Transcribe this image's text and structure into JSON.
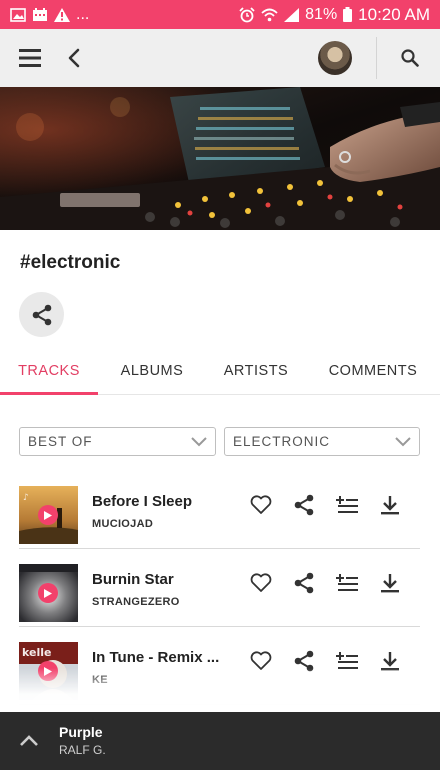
{
  "status_bar": {
    "left_icons": [
      "image-icon",
      "calendar-icon",
      "warning-icon"
    ],
    "more": "...",
    "battery": "81%",
    "time": "10:20 AM",
    "right_icons": [
      "alarm-icon",
      "wifi-icon",
      "signal-icon",
      "battery-icon"
    ]
  },
  "app_bar": {
    "icons": [
      "menu-icon",
      "back-arrow-icon",
      "avatar",
      "search-icon"
    ]
  },
  "page": {
    "title": "#electronic"
  },
  "tabs": [
    {
      "label": "TRACKS",
      "active": true
    },
    {
      "label": "ALBUMS",
      "active": false
    },
    {
      "label": "ARTISTS",
      "active": false
    },
    {
      "label": "COMMENTS",
      "active": false
    }
  ],
  "filters": {
    "sort": "BEST OF",
    "genre": "ELECTRONIC"
  },
  "tracks": [
    {
      "title": "Before I Sleep",
      "artist": "MUCIOJAD"
    },
    {
      "title": "Burnin Star",
      "artist": "STRANGEZERO"
    },
    {
      "title": "In Tune - Remix ...",
      "artist": "KE"
    }
  ],
  "now_playing": {
    "title": "Purple",
    "artist": "RALF G."
  },
  "colors": {
    "accent": "#f2416b",
    "app_bar": "#efefef",
    "player": "#2b2b2b"
  }
}
